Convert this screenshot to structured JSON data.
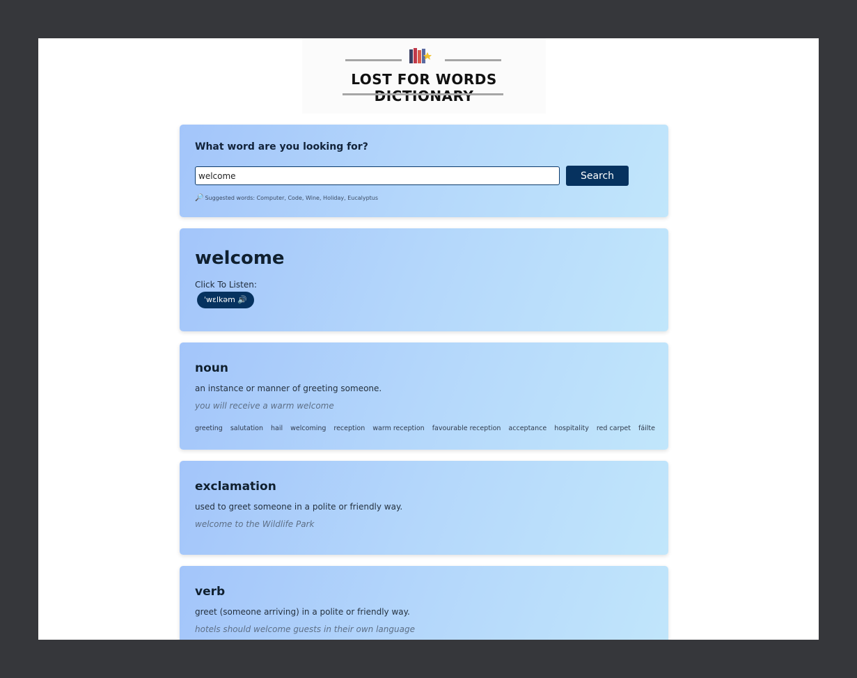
{
  "logo": {
    "title": "LOST FOR WORDS DICTIONARY"
  },
  "search": {
    "prompt": "What word are you looking for?",
    "value": "welcome",
    "button_label": "Search",
    "suggested": "Suggested words: Computer, Code, Wine, Holiday, Eucalyptus"
  },
  "entry": {
    "word": "welcome",
    "listen_label": "Click To Listen:",
    "phonetic": "ˈwɛlkəm 🔊"
  },
  "meanings": [
    {
      "pos": "noun",
      "definition": "an instance or manner of greeting someone.",
      "example": "you will receive a warm welcome",
      "synonyms": [
        "greeting",
        "salutation",
        "hail",
        "welcoming",
        "reception",
        "warm reception",
        "favourable reception",
        "acceptance",
        "hospitality",
        "red carpet",
        "fáilte"
      ]
    },
    {
      "pos": "exclamation",
      "definition": "used to greet someone in a polite or friendly way.",
      "example": "welcome to the Wildlife Park"
    },
    {
      "pos": "verb",
      "definition": "greet (someone arriving) in a polite or friendly way.",
      "example": "hotels should welcome guests in their own language"
    }
  ],
  "colors": {
    "accent": "#06325f",
    "backdrop": "#36373b"
  },
  "icons": {
    "suggest": "key-icon",
    "speaker": "speaker-icon"
  }
}
